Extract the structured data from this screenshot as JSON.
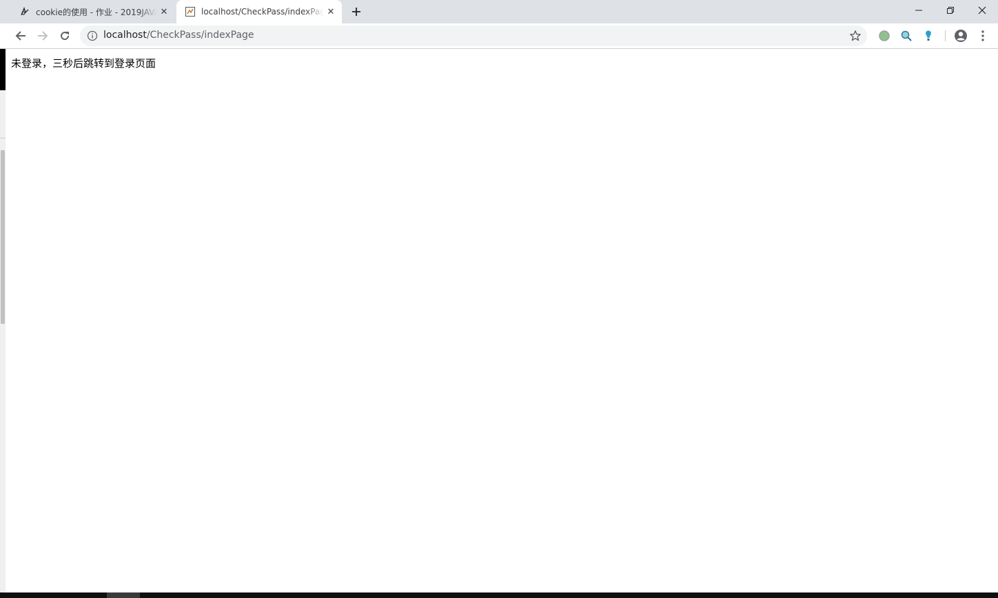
{
  "tabs": [
    {
      "title": "cookie的使用 - 作业 - 2019JAVA",
      "active": false
    },
    {
      "title": "localhost/CheckPass/indexPage",
      "active": true
    }
  ],
  "omnibox": {
    "host": "localhost",
    "path": "/CheckPass/indexPage"
  },
  "page": {
    "message": "未登录，三秒后跳转到登录页面"
  },
  "colors": {
    "tabstrip": "#dee1e6",
    "omnibox": "#f1f3f4",
    "icon": "#5f6368"
  },
  "icons": {
    "back": "arrow-left-icon",
    "forward": "arrow-right-icon",
    "reload": "reload-icon",
    "info": "info-icon",
    "star": "star-icon",
    "profile": "account-circle-icon",
    "menu": "more-vert-icon"
  }
}
